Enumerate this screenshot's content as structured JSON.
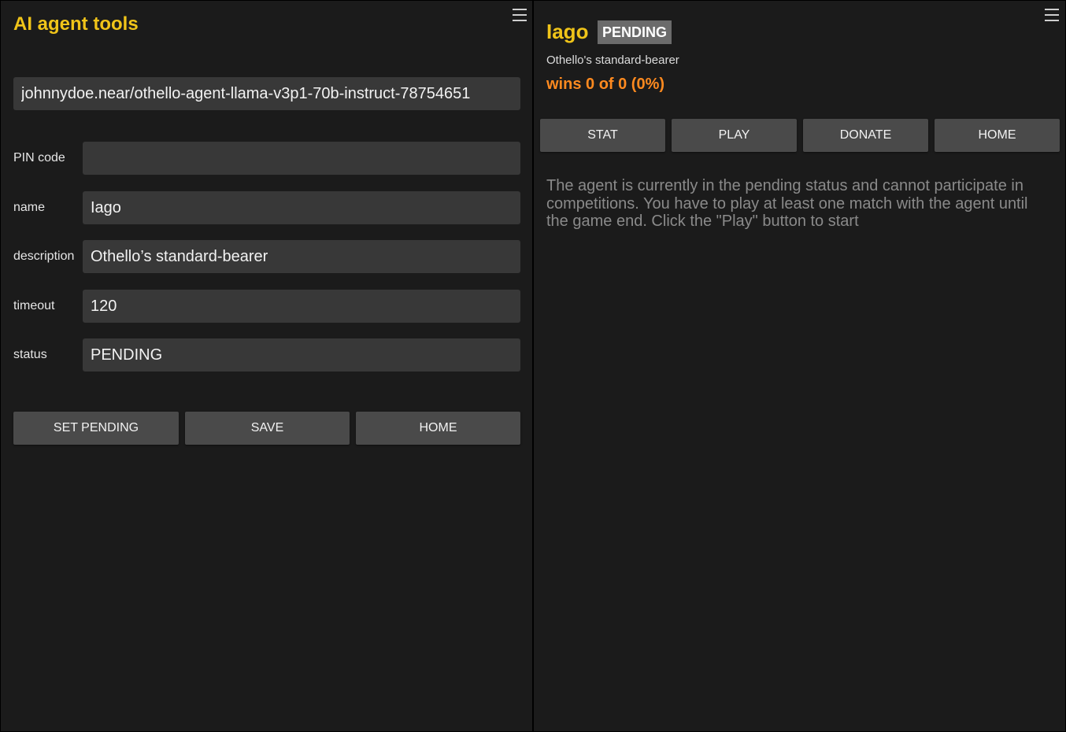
{
  "left_panel": {
    "title": "AI agent tools",
    "agent_id": "johnnydoe.near/othello-agent-llama-v3p1-70b-instruct-78754651",
    "form": {
      "pin_label": "PIN code",
      "pin_value": "",
      "name_label": "name",
      "name_value": "Iago",
      "description_label": "description",
      "description_value": "Othello’s standard-bearer",
      "timeout_label": "timeout",
      "timeout_value": "120",
      "status_label": "status",
      "status_value": "PENDING"
    },
    "buttons": {
      "set_pending": "SET PENDING",
      "save": "SAVE",
      "home": "HOME"
    }
  },
  "right_panel": {
    "agent_name": "Iago",
    "status_badge": "PENDING",
    "description": "Othello's standard-bearer",
    "wins": "wins 0 of 0 (0%)",
    "buttons": {
      "stat": "STAT",
      "play": "PLAY",
      "donate": "DONATE",
      "home": "HOME"
    },
    "info": "The agent is currently in the pending status and cannot participate in competitions. You have to play at least one match with the agent until the game end. Click the \"Play\" button to start"
  },
  "icons": {
    "menu": "hamburger-menu-icon"
  },
  "colors": {
    "background": "#1b1b1b",
    "accent_yellow": "#f0c419",
    "accent_orange": "#ff8a1f",
    "input_bg": "#383838",
    "button_bg": "#4a4a4a",
    "badge_bg": "#6b6b6b"
  }
}
